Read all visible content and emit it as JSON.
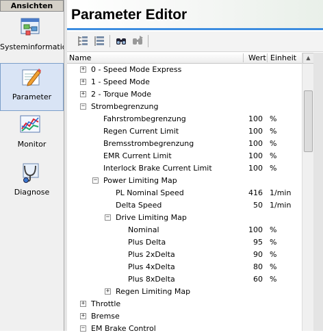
{
  "nav": {
    "header": "Ansichten",
    "items": [
      {
        "label": "Systeminformation",
        "icon": "system-info-icon"
      },
      {
        "label": "Parameter",
        "icon": "parameter-edit-icon",
        "selected": true
      },
      {
        "label": "Monitor",
        "icon": "monitor-chart-icon"
      },
      {
        "label": "Diagnose",
        "icon": "diagnose-stethoscope-icon"
      }
    ]
  },
  "editor": {
    "title": "Parameter Editor",
    "toolbar": [
      "expand-all-icon",
      "collapse-all-icon",
      "find-icon",
      "find-next-icon"
    ]
  },
  "grid": {
    "columns": {
      "name": "Name",
      "value": "Wert",
      "unit": "Einheit"
    },
    "rows": [
      {
        "level": 0,
        "expander": "+",
        "name": "0 - Speed Mode Express",
        "value": "",
        "unit": ""
      },
      {
        "level": 0,
        "expander": "+",
        "name": "1 - Speed Mode",
        "value": "",
        "unit": ""
      },
      {
        "level": 0,
        "expander": "+",
        "name": "2 - Torque Mode",
        "value": "",
        "unit": ""
      },
      {
        "level": 0,
        "expander": "−",
        "name": "Strombegrenzung",
        "value": "",
        "unit": ""
      },
      {
        "level": 1,
        "expander": "",
        "name": "Fahrstrombegrenzung",
        "value": "100",
        "unit": "%"
      },
      {
        "level": 1,
        "expander": "",
        "name": "Regen Current Limit",
        "value": "100",
        "unit": "%"
      },
      {
        "level": 1,
        "expander": "",
        "name": "Bremsstrombegrenzung",
        "value": "100",
        "unit": "%"
      },
      {
        "level": 1,
        "expander": "",
        "name": "EMR Current Limit",
        "value": "100",
        "unit": "%"
      },
      {
        "level": 1,
        "expander": "",
        "name": "Interlock Brake Current Limit",
        "value": "100",
        "unit": "%"
      },
      {
        "level": 1,
        "expander": "−",
        "name": "Power Limiting Map",
        "value": "",
        "unit": ""
      },
      {
        "level": 2,
        "expander": "",
        "name": "PL Nominal Speed",
        "value": "416",
        "unit": "1/min"
      },
      {
        "level": 2,
        "expander": "",
        "name": "Delta Speed",
        "value": "50",
        "unit": "1/min"
      },
      {
        "level": 2,
        "expander": "−",
        "name": "Drive Limiting Map",
        "value": "",
        "unit": ""
      },
      {
        "level": 3,
        "expander": "",
        "name": "Nominal",
        "value": "100",
        "unit": "%"
      },
      {
        "level": 3,
        "expander": "",
        "name": "Plus Delta",
        "value": "95",
        "unit": "%"
      },
      {
        "level": 3,
        "expander": "",
        "name": "Plus 2xDelta",
        "value": "90",
        "unit": "%"
      },
      {
        "level": 3,
        "expander": "",
        "name": "Plus 4xDelta",
        "value": "80",
        "unit": "%"
      },
      {
        "level": 3,
        "expander": "",
        "name": "Plus 8xDelta",
        "value": "60",
        "unit": "%"
      },
      {
        "level": 2,
        "expander": "+",
        "name": "Regen Limiting Map",
        "value": "",
        "unit": ""
      },
      {
        "level": 0,
        "expander": "+",
        "name": "Throttle",
        "value": "",
        "unit": ""
      },
      {
        "level": 0,
        "expander": "+",
        "name": "Bremse",
        "value": "",
        "unit": ""
      },
      {
        "level": 0,
        "expander": "−",
        "name": "EM Brake Control",
        "value": "",
        "unit": ""
      }
    ]
  },
  "colors": {
    "title_underline": "#3d8de0",
    "selected_nav": "#d9e4f5"
  }
}
